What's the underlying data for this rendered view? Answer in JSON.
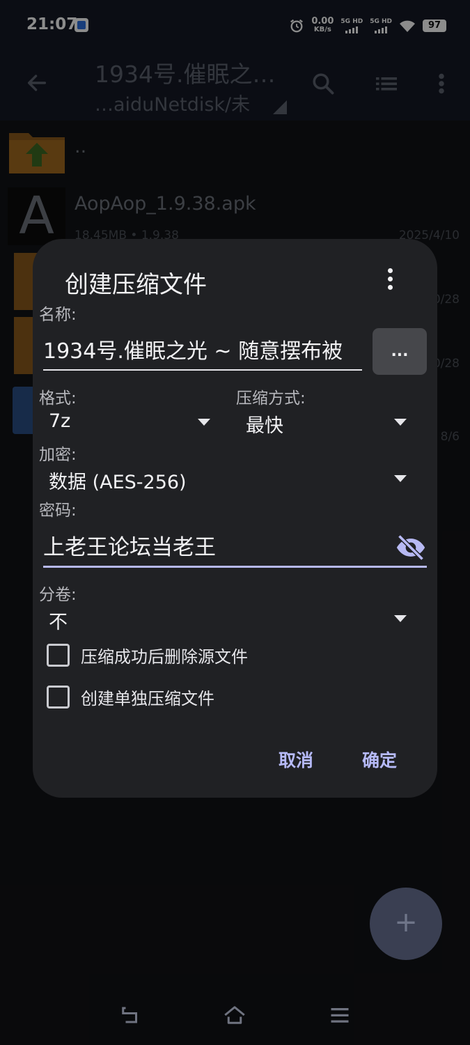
{
  "status_bar": {
    "time": "21:07",
    "net_speed_value": "0.00",
    "net_speed_unit": "KB/s",
    "sim1_label": "5G HD",
    "sim2_label": "5G HD",
    "battery": "97"
  },
  "app_bar": {
    "title": "1934号.催眠之…",
    "subtitle": "…aiduNetdisk/未"
  },
  "files": [
    {
      "name": "..",
      "meta": "",
      "date": ""
    },
    {
      "name": "AopAop_1.9.38.apk",
      "meta": "18.45MB   • 1.9.38",
      "date": "2025/4/10"
    },
    {
      "name": "",
      "meta": "",
      "date": "0/28"
    },
    {
      "name": "",
      "meta": "",
      "date": "0/28"
    },
    {
      "name": "",
      "meta": "",
      "date": "8/6"
    }
  ],
  "dialog": {
    "title": "创建压缩文件",
    "name_label": "名称:",
    "name_value": "1934号.催眠之光 ~ 随意摆布被",
    "browse_label": "...",
    "format_label": "格式:",
    "format_value": "7z",
    "method_label": "压缩方式:",
    "method_value": "最快",
    "encryption_label": "加密:",
    "encryption_value": "数据 (AES-256)",
    "password_label": "密码:",
    "password_value": "上老王论坛当老王",
    "split_label": "分卷:",
    "split_value": "不",
    "checkbox_delete_label": "压缩成功后删除源文件",
    "checkbox_separate_label": "创建单独压缩文件",
    "cancel_label": "取消",
    "ok_label": "确定"
  },
  "fab": {
    "label": "+"
  },
  "colors": {
    "accent": "#b6baf8",
    "dialog_bg": "#202124",
    "appbar_bg": "#141925"
  }
}
